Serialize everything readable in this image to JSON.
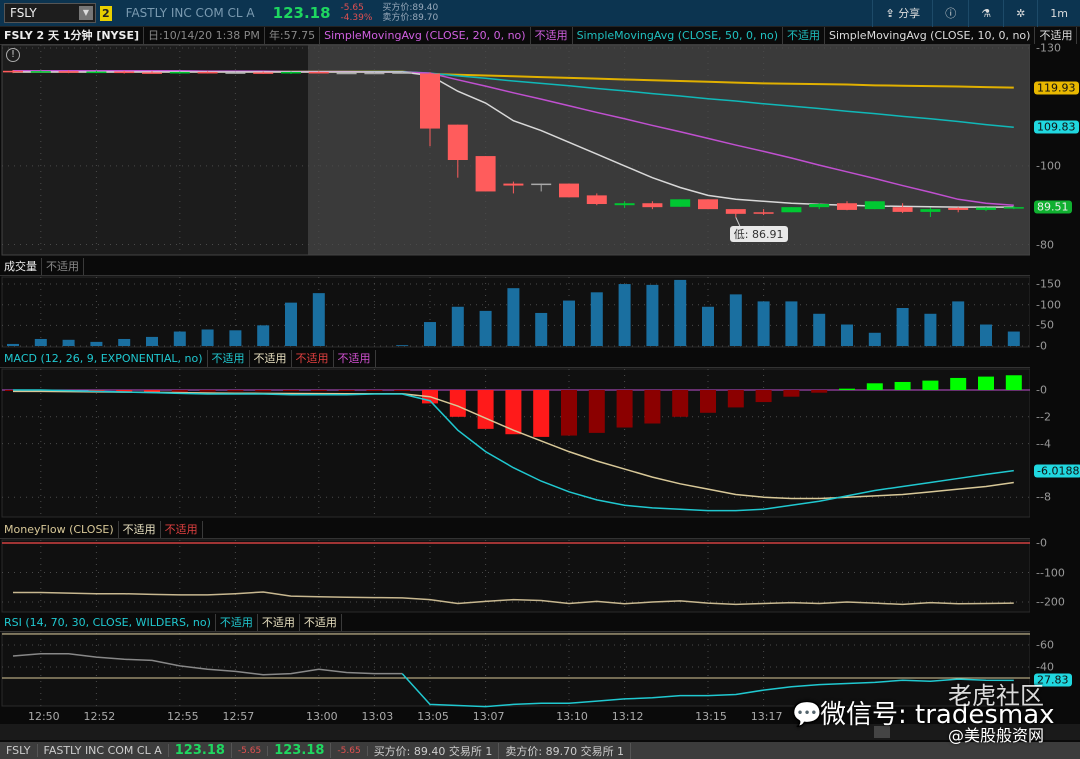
{
  "topbar": {
    "symbol": "FSLY",
    "link_badge": "2",
    "company": "FASTLY INC COM CL A",
    "last": "123.18",
    "change": "-5.65",
    "change_pct": "-4.39%",
    "bid": "买方价:89.40",
    "ask": "卖方价:89.70",
    "share": "分享",
    "interval": "1m"
  },
  "price_legend": {
    "title": "FSLY 2 天 1分钟 [NYSE]",
    "day": "日:10/14/20 1:38 PM",
    "year": "年:57.75",
    "sma20": "SimpleMovingAvg (CLOSE, 20, 0, no)",
    "sma20_na": "不适用",
    "sma50": "SimpleMovingAvg (CLOSE, 50, 0, no)",
    "sma50_na": "不适用",
    "sma10": "SimpleMovingAvg (CLOSE, 10, 0, no)",
    "sma10_na": "不适用",
    "more": "..."
  },
  "volume_legend": {
    "title": "成交量",
    "na": "不适用"
  },
  "macd_legend": {
    "title": "MACD (12, 26, 9, EXPONENTIAL, no)",
    "na1": "不适用",
    "na2": "不适用",
    "na3": "不适用",
    "na4": "不适用"
  },
  "mf_legend": {
    "title": "MoneyFlow (CLOSE)",
    "na1": "不适用",
    "na2": "不适用"
  },
  "rsi_legend": {
    "title": "RSI (14, 70, 30, CLOSE, WILDERS, no)",
    "na1": "不适用",
    "na2": "不适用",
    "na3": "不适用"
  },
  "axes": {
    "price_ticks": [
      "130",
      "100",
      "80"
    ],
    "price_tick_vals": [
      130,
      100,
      80
    ],
    "volume_ticks": [
      "150",
      "100",
      "50",
      "0"
    ],
    "volume_tick_vals": [
      150,
      100,
      50,
      0
    ],
    "macd_ticks": [
      "0",
      "-2",
      "-4",
      "-8"
    ],
    "macd_tick_vals": [
      0,
      -2,
      -4,
      -8
    ],
    "mf_ticks": [
      "0",
      "-100",
      "-200"
    ],
    "mf_tick_vals": [
      0,
      -100,
      -200
    ],
    "rsi_ticks": [
      "60",
      "40"
    ],
    "rsi_tick_vals": [
      60,
      40
    ],
    "badges": {
      "yellow": "119.93",
      "cyan": "109.83",
      "green": "89.51",
      "macd": "-6.0188",
      "rsi": "27.83"
    },
    "time_ticks": [
      {
        "label": "12:50",
        "i": 1
      },
      {
        "label": "12:52",
        "i": 3
      },
      {
        "label": "12:55",
        "i": 6
      },
      {
        "label": "12:57",
        "i": 8
      },
      {
        "label": "13:00",
        "i": 11
      },
      {
        "label": "13:03",
        "i": 13
      },
      {
        "label": "13:05",
        "i": 15
      },
      {
        "label": "13:07",
        "i": 17
      },
      {
        "label": "13:10",
        "i": 20
      },
      {
        "label": "13:12",
        "i": 22
      },
      {
        "label": "13:15",
        "i": 25
      },
      {
        "label": "13:17",
        "i": 27
      }
    ]
  },
  "low_annotation": {
    "label": "低: 86.91",
    "value": 86.91,
    "i": 26
  },
  "colors": {
    "up": "#00c832",
    "down": "#ff5c5c",
    "doji": "#aaaaaa",
    "sma10": "#d8d8d8",
    "sma20": "#c050d0",
    "sma50": "#10b8b8",
    "yellow": "#e0b000",
    "volume": "#1a6fa0",
    "macd": "#20c8d0",
    "signal": "#d8c898",
    "mf": "#c8b890",
    "rsi": "#20c8d0"
  },
  "chart_data": {
    "type": "candlestick",
    "candles": [
      [
        124.2,
        124.4,
        123.6,
        123.8
      ],
      [
        123.9,
        124.3,
        123.7,
        124.1
      ],
      [
        124.1,
        124.3,
        123.6,
        123.7
      ],
      [
        123.8,
        124.2,
        123.6,
        124.0
      ],
      [
        124.0,
        124.2,
        123.5,
        123.7
      ],
      [
        123.8,
        124.1,
        123.5,
        123.6
      ],
      [
        123.7,
        124.0,
        123.4,
        123.9
      ],
      [
        123.9,
        124.1,
        123.5,
        123.6
      ],
      [
        123.7,
        124.0,
        123.5,
        123.8
      ],
      [
        123.8,
        124.0,
        123.4,
        123.5
      ],
      [
        123.6,
        124.0,
        123.4,
        123.9
      ],
      [
        123.9,
        124.1,
        123.5,
        123.6
      ],
      [
        123.6,
        123.8,
        123.5,
        123.7
      ],
      [
        123.7,
        123.9,
        123.6,
        123.7
      ],
      [
        123.7,
        123.9,
        123.5,
        123.8
      ],
      [
        123.5,
        123.8,
        105,
        109.5
      ],
      [
        110.5,
        110.5,
        97,
        101.5
      ],
      [
        102.5,
        102.5,
        93.5,
        93.5
      ],
      [
        95.5,
        96,
        93,
        95
      ],
      [
        95.5,
        95.5,
        93.5,
        95.5
      ],
      [
        95.5,
        95.5,
        92,
        92
      ],
      [
        92.5,
        93,
        90,
        90.3
      ],
      [
        90,
        91,
        89.3,
        90.5
      ],
      [
        90.5,
        91,
        89,
        89.5
      ],
      [
        89.6,
        91.5,
        89.6,
        91.5
      ],
      [
        91.5,
        91.5,
        89,
        89
      ],
      [
        89,
        89,
        86.91,
        87.8
      ],
      [
        88.2,
        89,
        87.5,
        88
      ],
      [
        88.2,
        89.5,
        88.2,
        89.5
      ],
      [
        89.5,
        90.5,
        89,
        90.3
      ],
      [
        90.5,
        91,
        88.7,
        88.8
      ],
      [
        89,
        91,
        89,
        91
      ],
      [
        89.5,
        90.5,
        88,
        88.3
      ],
      [
        88.3,
        89.4,
        87,
        89
      ],
      [
        89.3,
        89.5,
        88.2,
        88.8
      ],
      [
        88.8,
        89.5,
        88.5,
        89.4
      ],
      [
        89.3,
        89.8,
        89,
        89.51
      ]
    ],
    "sma10": [
      123.9,
      123.9,
      123.9,
      123.9,
      123.9,
      123.9,
      123.9,
      123.9,
      123.9,
      123.9,
      123.9,
      123.9,
      123.9,
      123.9,
      123.9,
      123,
      119,
      116,
      111.5,
      109,
      106,
      103,
      100,
      97,
      94.5,
      92.5,
      91.5,
      91,
      90.5,
      90.2,
      90,
      89.8,
      89.7,
      89.6,
      89.5,
      89.5,
      89.5
    ],
    "sma20": [
      124.2,
      124.2,
      124.2,
      124.2,
      124.2,
      124.2,
      124.2,
      124.1,
      124.1,
      124.1,
      124,
      124,
      124,
      123.9,
      123.9,
      123.6,
      121.9,
      120.3,
      118.6,
      117,
      115.3,
      113.6,
      112,
      110.3,
      108.7,
      107,
      105.3,
      103.7,
      102,
      100.2,
      98.5,
      96.8,
      95,
      93.3,
      91.5,
      90.5,
      90
    ],
    "sma50": [
      124,
      124,
      124,
      124,
      124,
      124,
      124,
      124,
      124,
      124,
      124,
      124,
      124,
      124,
      124,
      123.6,
      122.9,
      122.3,
      121.6,
      121.0,
      120.4,
      119.7,
      119.1,
      118.4,
      117.8,
      117.1,
      116.5,
      115.8,
      115.2,
      114.6,
      113.9,
      113.3,
      112.6,
      112.0,
      111.3,
      110.5,
      109.83
    ],
    "yellow_ma": [
      124,
      124,
      124,
      124,
      124,
      124,
      124,
      124,
      124,
      124,
      124,
      124,
      124,
      124,
      124,
      123.4,
      123.2,
      123.0,
      122.8,
      122.6,
      122.4,
      122.2,
      122.0,
      121.8,
      121.6,
      121.4,
      121.2,
      121.0,
      120.9,
      120.8,
      120.7,
      120.5,
      120.4,
      120.3,
      120.2,
      120.05,
      119.93
    ],
    "volume": [
      5,
      17,
      15,
      10,
      17,
      22,
      35,
      40,
      38,
      50,
      105,
      128,
      0,
      0,
      2,
      58,
      95,
      85,
      140,
      80,
      110,
      130,
      150,
      148,
      160,
      95,
      125,
      108,
      108,
      78,
      52,
      32,
      92,
      78,
      108,
      52,
      35
    ],
    "macd_hist": [
      -0.05,
      -0.05,
      -0.08,
      -0.1,
      -0.12,
      -0.15,
      -0.15,
      -0.12,
      -0.1,
      -0.1,
      -0.08,
      -0.08,
      -0.05,
      -0.05,
      -0.05,
      -1,
      -2,
      -2.9,
      -3.3,
      -3.5,
      -3.4,
      -3.2,
      -2.8,
      -2.5,
      -2,
      -1.7,
      -1.3,
      -0.9,
      -0.5,
      -0.2,
      0.1,
      0.5,
      0.6,
      0.7,
      0.9,
      1.0,
      1.1
    ],
    "macd": [
      0,
      0,
      -0.05,
      -0.1,
      -0.15,
      -0.2,
      -0.25,
      -0.3,
      -0.3,
      -0.3,
      -0.35,
      -0.35,
      -0.35,
      -0.3,
      -0.3,
      -0.8,
      -3,
      -4.6,
      -5.8,
      -6.8,
      -7.6,
      -8.2,
      -8.6,
      -8.8,
      -8.9,
      -9.0,
      -9.0,
      -8.9,
      -8.6,
      -8.3,
      -7.9,
      -7.5,
      -7.2,
      -6.9,
      -6.6,
      -6.3,
      -6.0188
    ],
    "signal": [
      -0.1,
      -0.1,
      -0.12,
      -0.14,
      -0.16,
      -0.18,
      -0.2,
      -0.22,
      -0.24,
      -0.25,
      -0.26,
      -0.27,
      -0.28,
      -0.28,
      -0.28,
      -0.5,
      -1.2,
      -2.1,
      -3.0,
      -3.8,
      -4.6,
      -5.3,
      -5.9,
      -6.5,
      -7.0,
      -7.4,
      -7.8,
      -8.0,
      -8.1,
      -8.1,
      -8.0,
      -7.9,
      -7.8,
      -7.6,
      -7.4,
      -7.2,
      -6.9
    ],
    "moneyflow": [
      -168,
      -168,
      -170,
      -172,
      -172,
      -174,
      -176,
      -176,
      -172,
      -166,
      -180,
      -182,
      -184,
      -185,
      -186,
      -192,
      -205,
      -198,
      -192,
      -195,
      -205,
      -198,
      -206,
      -200,
      -196,
      -204,
      -208,
      -205,
      -202,
      -205,
      -200,
      -204,
      -208,
      -202,
      -206,
      -205,
      -204
    ],
    "rsi": [
      50,
      52,
      52,
      49,
      47,
      46,
      41,
      38,
      36,
      33,
      34,
      38,
      35,
      34,
      34,
      6,
      5,
      4,
      6,
      7,
      7,
      9,
      11,
      12,
      14,
      14,
      15,
      19,
      22,
      24,
      25,
      26,
      28,
      27,
      29,
      28,
      27.83
    ],
    "rsi_levels": [
      70,
      30
    ],
    "price_ylim": [
      80,
      130
    ],
    "volume_ylim": [
      0,
      150
    ],
    "macd_ylim": [
      -9,
      1.5
    ],
    "mf_ylim": [
      -220,
      0
    ],
    "rsi_ylim": [
      0,
      70
    ]
  },
  "bottom": {
    "symbol": "FSLY",
    "company": "FASTLY INC COM CL A",
    "last1": "123.18",
    "chg1": "-5.65",
    "last2": "123.18",
    "chg2": "-5.65",
    "bid": "买方价: 89.40 交易所 1",
    "ask": "卖方价: 89.70 交易所 1"
  },
  "watermark": {
    "wechat": "微信号: tradesmax",
    "tiger": "老虎社区",
    "site": "@美股般资网"
  }
}
